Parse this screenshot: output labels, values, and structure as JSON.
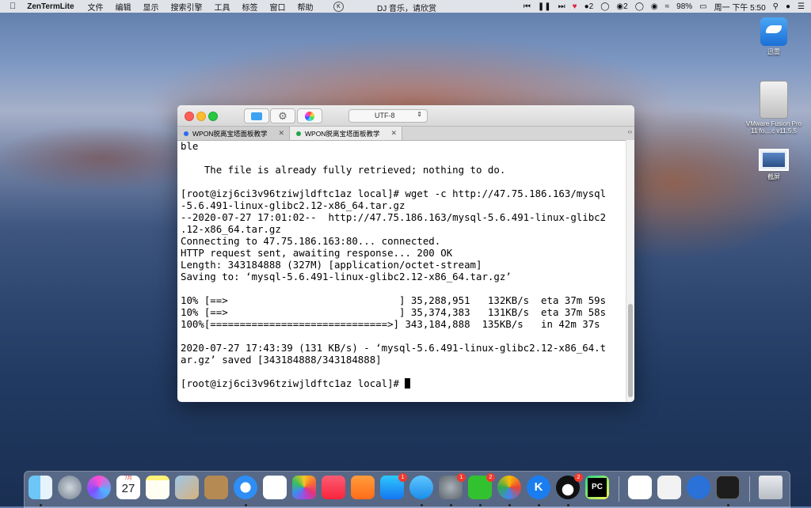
{
  "menubar": {
    "app_name": "ZenTermLite",
    "menus": [
      "文件",
      "编辑",
      "显示",
      "搜索引擎",
      "工具",
      "标签",
      "窗口",
      "帮助"
    ],
    "song": "DJ 音乐，请欣赏",
    "wechat_count": "2",
    "qq_count": "2",
    "battery": "98%",
    "clock": "周一 下午 5:50"
  },
  "desktop": {
    "icons": [
      {
        "label": "迅雷",
        "icon": "thunder-bird-icon"
      },
      {
        "label": "VMware Fusion Pro 11 fo....c v11.5.5",
        "icon": "disk-image-icon"
      },
      {
        "label": "截屏",
        "icon": "screenshot-icon"
      }
    ]
  },
  "window": {
    "encoding": "UTF-8",
    "tabs": [
      {
        "label": "WPON脱离宝塔面板教学",
        "dot_color": "#2a6bef"
      },
      {
        "label": "WPON脱离宝塔面板教学",
        "dot_color": "#1fa84a"
      }
    ]
  },
  "terminal": {
    "lines": [
      "ble",
      "",
      "    The file is already fully retrieved; nothing to do.",
      "",
      "[root@izj6ci3v96tziwjldftc1az local]# wget -c http://47.75.186.163/mysql",
      "-5.6.491-linux-glibc2.12-x86_64.tar.gz",
      "--2020-07-27 17:01:02--  http://47.75.186.163/mysql-5.6.491-linux-glibc2",
      ".12-x86_64.tar.gz",
      "Connecting to 47.75.186.163:80... connected.",
      "HTTP request sent, awaiting response... 200 OK",
      "Length: 343184888 (327M) [application/octet-stream]",
      "Saving to: ‘mysql-5.6.491-linux-glibc2.12-x86_64.tar.gz’",
      "",
      "10% [==>                             ] 35,288,951   132KB/s  eta 37m 59s",
      "10% [==>                             ] 35,374,383   131KB/s  eta 37m 58s",
      "100%[==============================>] 343,184,888  135KB/s   in 42m 37s",
      "",
      "2020-07-27 17:43:39 (131 KB/s) - ‘mysql-5.6.491-linux-glibc2.12-x86_64.t",
      "ar.gz’ saved [343184888/343184888]",
      "",
      "[root@izj6ci3v96tziwjldftc1az local]# "
    ]
  },
  "dock": {
    "calendar_month": "7月",
    "calendar_day": "27",
    "app_store_badge": "1",
    "sys_prefs_badge": "1",
    "wechat_badge": "2",
    "qq_badge": "2",
    "pycharm_label": "PC",
    "k_label": "K"
  }
}
